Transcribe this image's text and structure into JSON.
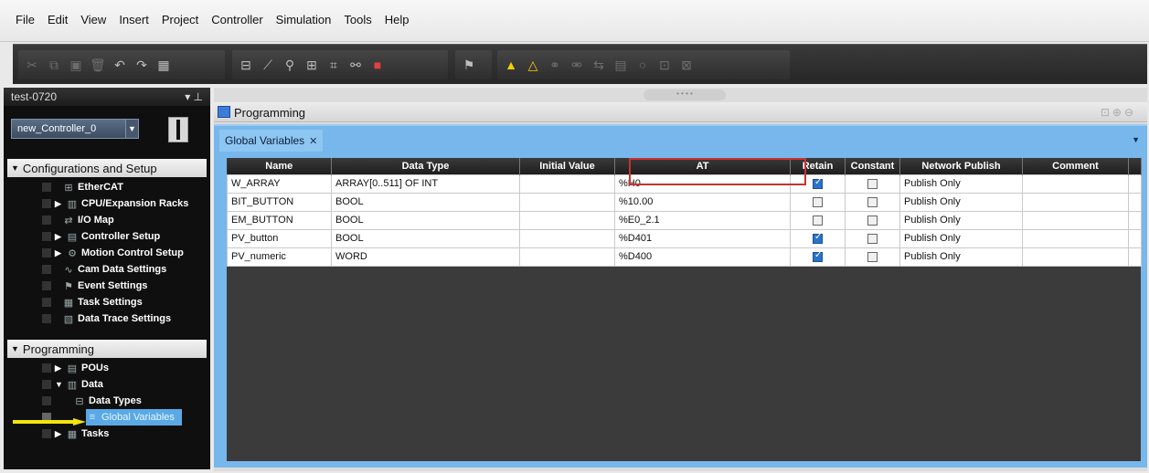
{
  "menu": [
    "File",
    "Edit",
    "View",
    "Insert",
    "Project",
    "Controller",
    "Simulation",
    "Tools",
    "Help"
  ],
  "toolbar": {
    "group1": [
      "cut-icon",
      "copy-icon",
      "paste-icon",
      "delete-icon",
      "undo-icon",
      "redo-icon",
      "help-icon"
    ],
    "group2": [
      "window-icon",
      "tool-icon",
      "cross-reference-icon",
      "table-icon",
      "find-icon",
      "binoculars-icon",
      "stop-icon"
    ],
    "group3": [
      "build-icon"
    ],
    "group4": [
      "warning-icon",
      "warning-alt-icon",
      "link-icon",
      "link-alt-icon",
      "transfer-icon",
      "monitor-icon",
      "online-icon",
      "compare-icon",
      "compare-alt-icon"
    ]
  },
  "left_panel": {
    "title": "test-0720",
    "controller": "new_Controller_0",
    "sections": {
      "config": "Configurations and Setup",
      "programming": "Programming"
    },
    "config_items": [
      "EtherCAT",
      "CPU/Expansion Racks",
      "I/O Map",
      "Controller Setup",
      "Motion Control Setup",
      "Cam Data Settings",
      "Event Settings",
      "Task Settings",
      "Data Trace Settings"
    ],
    "programming_items": [
      "POUs",
      "Data",
      "Data Types",
      "Global Variables",
      "Tasks"
    ]
  },
  "editor": {
    "title": "Programming",
    "tab": "Global Variables",
    "columns": [
      "Name",
      "Data Type",
      "Initial Value",
      "AT",
      "Retain",
      "Constant",
      "Network Publish",
      "Comment"
    ],
    "rows": [
      {
        "name": "W_ARRAY",
        "type": "ARRAY[0..511] OF INT",
        "initial": "",
        "at": "%H0",
        "retain": true,
        "constant": false,
        "publish": "Publish Only",
        "comment": ""
      },
      {
        "name": "BIT_BUTTON",
        "type": "BOOL",
        "initial": "",
        "at": "%10.00",
        "retain": false,
        "constant": false,
        "publish": "Publish Only",
        "comment": ""
      },
      {
        "name": "EM_BUTTON",
        "type": "BOOL",
        "initial": "",
        "at": "%E0_2.1",
        "retain": false,
        "constant": false,
        "publish": "Publish Only",
        "comment": ""
      },
      {
        "name": "PV_button",
        "type": "BOOL",
        "initial": "",
        "at": "%D401",
        "retain": true,
        "constant": false,
        "publish": "Publish Only",
        "comment": ""
      },
      {
        "name": "PV_numeric",
        "type": "WORD",
        "initial": "",
        "at": "%D400",
        "retain": true,
        "constant": false,
        "publish": "Publish Only",
        "comment": ""
      }
    ]
  },
  "colors": {
    "accent": "#77b7ec",
    "highlight": "#c83232",
    "arrow": "#f4e40b"
  }
}
